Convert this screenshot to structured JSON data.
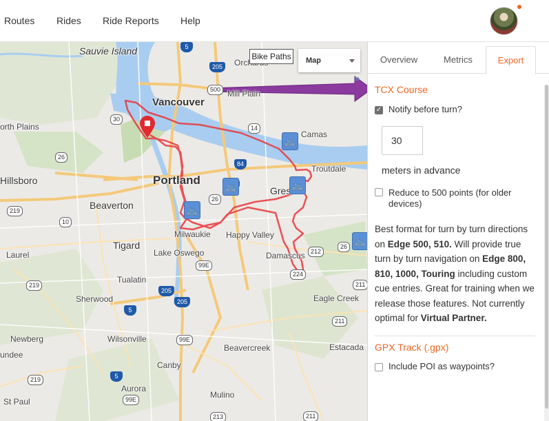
{
  "nav": {
    "items": [
      "Routes",
      "Rides",
      "Ride Reports",
      "Help"
    ]
  },
  "map": {
    "bike_paths_label": "Bike Paths",
    "map_type": "Map",
    "collapse_glyph": "»",
    "labels": {
      "sauvie_island": "Sauvie Island",
      "orchards": "Orchards",
      "vancouver": "Vancouver",
      "mill_plain": "Mill Plain",
      "north_plains": "orth Plains",
      "camas": "Camas",
      "troutdale": "Troutdale",
      "hillsboro": "Hillsboro",
      "portland": "Portland",
      "gresham": "Gresh",
      "beaverton": "Beaverton",
      "tigard": "Tigard",
      "milwaukie": "Milwaukie",
      "happy_valley": "Happy Valley",
      "laurel": "Laurel",
      "lake_oswego": "Lake Oswego",
      "damascus": "Damascus",
      "tualatin": "Tualatin",
      "sherwood": "Sherwood",
      "eagle_creek": "Eagle Creek",
      "newberg": "Newberg",
      "wilsonville": "Wilsonville",
      "beavercreek": "Beavercreek",
      "estacada": "Estacada",
      "undee": "undee",
      "canby": "Canby",
      "st_paul": "St Paul",
      "aurora": "Aurora",
      "mulino": "Mulino"
    },
    "shields": {
      "i5_top": "5",
      "i205_top": "205",
      "r500": "500",
      "r14": "14",
      "r30": "30",
      "r26_west": "26",
      "i84": "84",
      "i205_mid": "205",
      "r26_mid": "26",
      "r219_west": "219",
      "r10": "10",
      "r99e_1": "99E",
      "r224": "224",
      "r212": "212",
      "r26_east": "26",
      "r211_east": "211",
      "r219_sw": "219",
      "i205_low_a": "205",
      "i205_low_b": "205",
      "i5_mid": "5",
      "r211_mid": "211",
      "r99e_2": "99E",
      "r219_s": "219",
      "i5_low": "5",
      "r99e_3": "99E",
      "r211_bot": "211",
      "r213": "213"
    }
  },
  "panel": {
    "tabs": [
      "Overview",
      "Metrics",
      "Export"
    ],
    "active_tab": "Export",
    "tcx": {
      "title": "TCX Course",
      "notify_label": "Notify before turn?",
      "notify_checked": true,
      "distance_value": "30",
      "distance_suffix": "meters in advance",
      "reduce_label": "Reduce to 500 points (for older devices)",
      "reduce_checked": false,
      "desc_1": "Best format for turn by turn directions on ",
      "desc_b1": "Edge 500, 510.",
      "desc_2": " Will provide true turn by turn navigation on ",
      "desc_b2": "Edge 800, 810, 1000, Touring",
      "desc_3": " including custom cue entries. Great for training when we release those features. Not currently optimal for ",
      "desc_b3": "Virtual Partner."
    },
    "gpx": {
      "title": "GPX Track (.gpx)",
      "poi_label": "Include POI as waypoints?",
      "poi_checked": false
    }
  },
  "colors": {
    "accent": "#f26522",
    "route": "#e8363c",
    "water": "#a9cdf0",
    "arrow": "#8b3a9e"
  }
}
